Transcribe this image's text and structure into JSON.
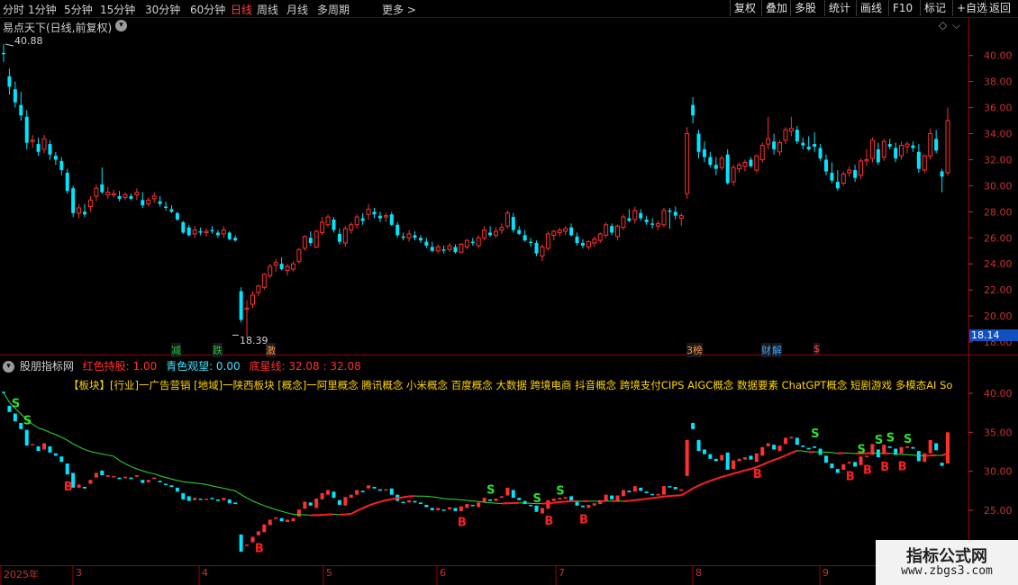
{
  "toolbar": {
    "periods": [
      {
        "label": "分时",
        "active": false
      },
      {
        "label": "1分钟",
        "active": false
      },
      {
        "label": "5分钟",
        "active": false
      },
      {
        "label": "15分钟",
        "active": false
      },
      {
        "label": "30分钟",
        "active": false
      },
      {
        "label": "60分钟",
        "active": false
      },
      {
        "label": "日线",
        "active": true
      },
      {
        "label": "周线",
        "active": false
      },
      {
        "label": "月线",
        "active": false
      },
      {
        "label": "多周期",
        "active": false
      }
    ],
    "more_label": "更多 >",
    "right_buttons": [
      "复权",
      "叠加",
      "多股",
      "统计",
      "画线",
      "F10",
      "标记",
      "+自选",
      "返回"
    ]
  },
  "main_pane": {
    "title": "易点天下(日线,前复权)",
    "dropdown_icon": "chevron-down-icon",
    "high_label": "40.88",
    "low_label": "18.39",
    "current_price": "18.14",
    "y_axis": [
      "40.00",
      "38.00",
      "36.00",
      "34.00",
      "32.00",
      "30.00",
      "28.00",
      "26.00",
      "24.00",
      "22.00",
      "20.00",
      "18.00"
    ],
    "events": [
      {
        "text": "减",
        "color": "#20c040"
      },
      {
        "text": "跌",
        "color": "#20c040"
      },
      {
        "text": "激",
        "color": "#ff9040"
      },
      {
        "text": "3榜",
        "color": "#ff9040"
      },
      {
        "text": "财",
        "color": "#40a0ff"
      },
      {
        "text": "解",
        "color": "#40a0ff"
      },
      {
        "text": "$",
        "color": "#ff4040"
      }
    ]
  },
  "indicator_pane": {
    "name": "股朋指标网",
    "red_label": "红色持股: 1.00",
    "cyan_label": "青色观望: 0.00",
    "base_label": "底星线: 32.08 : 32.08",
    "tags_text": "【板块】[行业]一广告营销 [地域]一陕西板块 [概念]一阿里概念 腾讯概念 小米概念 百度概念 大数据 跨境电商 抖音概念 跨境支付CIPS AIGC概念 数据要素 ChatGPT概念 短剧游戏 多模态AI So",
    "y_axis": [
      "40.00",
      "35.00",
      "30.00",
      "25.00"
    ],
    "buy_marker": "B",
    "sell_marker": "S"
  },
  "x_axis": [
    "2025年",
    "3",
    "4",
    "5",
    "6",
    "7",
    "8",
    "9"
  ],
  "watermark": {
    "line1": "指标公式网",
    "line2": "www.zbgs3.com"
  },
  "colors": {
    "up": "#ff3030",
    "down": "#00e5ff",
    "bg": "#000000",
    "axis": "#7a0000",
    "ma_green": "#30e030",
    "ma_red": "#ff2020",
    "buy": "#ff2020",
    "sell": "#30e030"
  },
  "chart_data": {
    "type": "candlestick",
    "y_range": [
      18.0,
      41.5
    ],
    "candles": [
      [
        40.2,
        40.88,
        39.5,
        40.1
      ],
      [
        38.4,
        39.0,
        37.0,
        37.6
      ],
      [
        37.4,
        38.0,
        36.0,
        36.4
      ],
      [
        36.2,
        37.2,
        35.0,
        35.4
      ],
      [
        35.3,
        35.8,
        32.8,
        33.3
      ],
      [
        33.4,
        33.9,
        32.9,
        33.5
      ],
      [
        33.2,
        33.7,
        32.3,
        32.6
      ],
      [
        32.8,
        33.9,
        32.5,
        33.6
      ],
      [
        33.2,
        33.5,
        32.0,
        32.4
      ],
      [
        32.3,
        32.6,
        31.6,
        32.0
      ],
      [
        31.9,
        32.2,
        30.8,
        31.2
      ],
      [
        31.0,
        31.3,
        29.4,
        29.6
      ],
      [
        29.8,
        30.0,
        27.6,
        27.9
      ],
      [
        27.9,
        28.6,
        27.5,
        28.3
      ],
      [
        28.0,
        28.6,
        27.6,
        27.8
      ],
      [
        28.4,
        29.2,
        28.0,
        28.9
      ],
      [
        29.2,
        30.1,
        28.8,
        29.8
      ],
      [
        30.1,
        31.4,
        29.4,
        29.5
      ],
      [
        29.3,
        29.9,
        29.0,
        29.5
      ],
      [
        29.3,
        29.7,
        29.1,
        29.4
      ],
      [
        29.2,
        29.6,
        28.8,
        29.0
      ],
      [
        29.1,
        29.5,
        28.9,
        29.3
      ],
      [
        29.2,
        29.4,
        28.9,
        29.0
      ],
      [
        29.3,
        29.8,
        28.9,
        29.5
      ],
      [
        28.9,
        29.5,
        28.3,
        28.5
      ],
      [
        28.6,
        29.1,
        28.4,
        28.9
      ],
      [
        29.0,
        29.5,
        28.7,
        29.2
      ],
      [
        28.8,
        29.2,
        28.4,
        28.6
      ],
      [
        28.4,
        28.8,
        28.1,
        28.3
      ],
      [
        28.2,
        28.5,
        27.9,
        28.0
      ],
      [
        27.9,
        28.0,
        27.3,
        27.4
      ],
      [
        27.2,
        27.3,
        26.3,
        26.4
      ],
      [
        26.8,
        27.0,
        26.1,
        26.2
      ],
      [
        26.3,
        26.9,
        26.0,
        26.6
      ],
      [
        26.5,
        26.8,
        26.2,
        26.4
      ],
      [
        26.4,
        26.7,
        26.1,
        26.5
      ],
      [
        26.6,
        26.9,
        26.3,
        26.5
      ],
      [
        26.4,
        26.6,
        26.0,
        26.2
      ],
      [
        26.3,
        26.9,
        26.0,
        26.6
      ],
      [
        26.4,
        26.5,
        25.8,
        25.9
      ],
      [
        26.0,
        26.2,
        25.7,
        25.8
      ],
      [
        21.9,
        22.2,
        19.5,
        19.7
      ],
      [
        20.5,
        21.2,
        18.39,
        20.6
      ],
      [
        20.9,
        21.9,
        20.6,
        21.6
      ],
      [
        21.8,
        22.4,
        21.5,
        22.3
      ],
      [
        22.2,
        23.3,
        22.0,
        23.2
      ],
      [
        23.1,
        24.0,
        22.9,
        23.8
      ],
      [
        23.9,
        24.4,
        23.4,
        24.1
      ],
      [
        24.0,
        24.5,
        23.5,
        23.6
      ],
      [
        23.5,
        24.0,
        23.1,
        23.8
      ],
      [
        23.6,
        24.2,
        23.4,
        24.0
      ],
      [
        24.2,
        25.2,
        24.0,
        25.1
      ],
      [
        25.2,
        26.2,
        25.0,
        26.1
      ],
      [
        26.0,
        26.5,
        25.4,
        25.6
      ],
      [
        25.3,
        26.6,
        25.2,
        26.5
      ],
      [
        26.4,
        27.6,
        26.2,
        27.2
      ],
      [
        27.0,
        27.8,
        26.8,
        27.6
      ],
      [
        27.4,
        27.6,
        26.4,
        26.6
      ],
      [
        26.3,
        26.7,
        25.5,
        25.7
      ],
      [
        25.6,
        26.9,
        25.3,
        26.7
      ],
      [
        26.6,
        27.2,
        26.3,
        27.0
      ],
      [
        27.0,
        27.8,
        26.7,
        27.6
      ],
      [
        27.5,
        27.9,
        27.0,
        27.3
      ],
      [
        27.8,
        28.6,
        27.4,
        28.2
      ],
      [
        28.0,
        28.3,
        27.5,
        27.8
      ],
      [
        27.7,
        28.0,
        27.2,
        27.5
      ],
      [
        27.6,
        27.9,
        27.2,
        27.7
      ],
      [
        27.8,
        28.0,
        26.9,
        27.0
      ],
      [
        27.0,
        27.2,
        26.0,
        26.2
      ],
      [
        26.1,
        26.4,
        25.8,
        26.0
      ],
      [
        26.0,
        26.6,
        25.7,
        26.3
      ],
      [
        26.2,
        26.5,
        25.8,
        26.0
      ],
      [
        26.0,
        26.2,
        25.6,
        25.8
      ],
      [
        25.7,
        26.0,
        25.2,
        25.4
      ],
      [
        25.3,
        25.7,
        24.9,
        25.0
      ],
      [
        25.0,
        25.5,
        24.8,
        25.3
      ],
      [
        25.1,
        25.4,
        24.8,
        25.0
      ],
      [
        25.1,
        25.6,
        24.9,
        25.4
      ],
      [
        25.3,
        25.5,
        24.8,
        24.9
      ],
      [
        24.9,
        25.6,
        24.8,
        25.5
      ],
      [
        25.3,
        25.9,
        25.1,
        25.8
      ],
      [
        25.7,
        26.0,
        25.4,
        25.6
      ],
      [
        25.4,
        26.2,
        25.2,
        26.0
      ],
      [
        26.0,
        26.9,
        25.8,
        26.6
      ],
      [
        26.4,
        26.9,
        26.1,
        26.2
      ],
      [
        26.2,
        26.8,
        26.0,
        26.5
      ],
      [
        26.6,
        27.1,
        26.3,
        26.8
      ],
      [
        26.9,
        28.1,
        26.7,
        27.9
      ],
      [
        27.6,
        27.9,
        26.4,
        26.6
      ],
      [
        26.6,
        26.9,
        26.2,
        26.3
      ],
      [
        26.2,
        26.6,
        25.7,
        25.8
      ],
      [
        25.7,
        26.0,
        25.3,
        25.6
      ],
      [
        25.6,
        25.8,
        24.6,
        24.8
      ],
      [
        24.6,
        25.5,
        24.2,
        25.3
      ],
      [
        25.2,
        26.5,
        25.0,
        26.3
      ],
      [
        26.2,
        26.6,
        25.8,
        26.5
      ],
      [
        26.4,
        26.8,
        26.1,
        26.6
      ],
      [
        26.5,
        26.9,
        26.2,
        26.7
      ],
      [
        26.8,
        27.1,
        26.1,
        26.2
      ],
      [
        26.1,
        26.4,
        25.4,
        25.6
      ],
      [
        25.6,
        25.9,
        25.2,
        25.4
      ],
      [
        25.3,
        25.8,
        25.1,
        25.7
      ],
      [
        25.6,
        26.1,
        25.3,
        25.9
      ],
      [
        25.8,
        26.4,
        25.6,
        26.3
      ],
      [
        26.2,
        27.2,
        26.0,
        27.0
      ],
      [
        26.9,
        27.1,
        26.2,
        26.4
      ],
      [
        26.1,
        27.0,
        25.8,
        26.9
      ],
      [
        26.8,
        27.8,
        26.6,
        27.6
      ],
      [
        27.5,
        28.2,
        27.2,
        27.3
      ],
      [
        27.4,
        28.4,
        27.1,
        28.1
      ],
      [
        27.9,
        28.2,
        27.3,
        27.5
      ],
      [
        27.4,
        27.7,
        27.0,
        27.2
      ],
      [
        27.1,
        27.5,
        26.7,
        27.0
      ],
      [
        26.9,
        27.3,
        26.6,
        27.1
      ],
      [
        27.0,
        28.3,
        26.8,
        28.1
      ],
      [
        28.1,
        28.3,
        26.7,
        28.0
      ],
      [
        28.0,
        28.4,
        27.4,
        27.7
      ],
      [
        27.5,
        27.9,
        26.9,
        27.7
      ],
      [
        29.4,
        34.5,
        29.0,
        34.0
      ],
      [
        36.2,
        36.8,
        34.8,
        35.4
      ],
      [
        34.0,
        34.3,
        32.1,
        32.6
      ],
      [
        32.8,
        33.4,
        31.8,
        32.2
      ],
      [
        32.2,
        32.6,
        31.4,
        31.6
      ],
      [
        31.6,
        32.2,
        30.8,
        31.3
      ],
      [
        31.4,
        32.3,
        31.2,
        32.1
      ],
      [
        32.4,
        32.8,
        30.1,
        30.2
      ],
      [
        30.3,
        31.6,
        30.0,
        31.4
      ],
      [
        31.3,
        31.8,
        31.0,
        31.6
      ],
      [
        31.5,
        32.0,
        31.1,
        31.8
      ],
      [
        32.0,
        32.2,
        31.4,
        31.5
      ],
      [
        31.2,
        32.4,
        31.0,
        32.3
      ],
      [
        32.0,
        33.3,
        31.8,
        33.1
      ],
      [
        33.2,
        35.3,
        32.8,
        33.6
      ],
      [
        33.4,
        34.0,
        32.4,
        32.8
      ],
      [
        32.6,
        33.5,
        32.3,
        33.3
      ],
      [
        33.5,
        34.5,
        33.2,
        34.3
      ],
      [
        34.2,
        35.3,
        33.8,
        34.4
      ],
      [
        34.3,
        34.6,
        33.2,
        33.4
      ],
      [
        33.3,
        33.7,
        32.8,
        33.1
      ],
      [
        33.0,
        33.8,
        32.7,
        32.8
      ],
      [
        33.2,
        34.1,
        32.6,
        33.0
      ],
      [
        32.9,
        33.2,
        31.9,
        32.1
      ],
      [
        32.0,
        32.4,
        30.8,
        31.1
      ],
      [
        31.0,
        31.8,
        30.2,
        30.4
      ],
      [
        30.3,
        31.2,
        29.6,
        29.8
      ],
      [
        30.2,
        31.1,
        30.0,
        30.9
      ],
      [
        31.0,
        31.5,
        30.7,
        31.2
      ],
      [
        31.2,
        31.6,
        30.3,
        30.6
      ],
      [
        30.8,
        32.1,
        30.5,
        31.9
      ],
      [
        31.9,
        32.8,
        31.5,
        32.0
      ],
      [
        32.1,
        33.7,
        31.8,
        33.5
      ],
      [
        32.8,
        33.3,
        31.6,
        31.8
      ],
      [
        32.2,
        33.6,
        31.9,
        33.4
      ],
      [
        33.2,
        33.6,
        32.8,
        33.0
      ],
      [
        32.9,
        33.3,
        31.8,
        32.1
      ],
      [
        32.3,
        33.4,
        32.0,
        33.1
      ],
      [
        33.0,
        33.4,
        32.5,
        33.2
      ],
      [
        33.1,
        33.4,
        32.6,
        32.9
      ],
      [
        32.6,
        33.2,
        31.0,
        31.3
      ],
      [
        31.2,
        32.4,
        31.0,
        32.3
      ],
      [
        32.3,
        34.4,
        32.0,
        34.0
      ],
      [
        33.6,
        34.3,
        32.5,
        32.7
      ],
      [
        31.1,
        31.3,
        29.5,
        30.7
      ],
      [
        31.0,
        36.0,
        30.8,
        35.0
      ]
    ],
    "indicator_candles_note": "same OHLC series rendered in indicator pane",
    "buy_signal_indices": [
      11,
      44,
      79,
      94,
      100,
      130,
      146,
      149,
      152,
      155
    ],
    "sell_signal_indices": [
      2,
      4,
      84,
      92,
      96,
      140,
      148,
      151,
      153,
      156
    ]
  }
}
